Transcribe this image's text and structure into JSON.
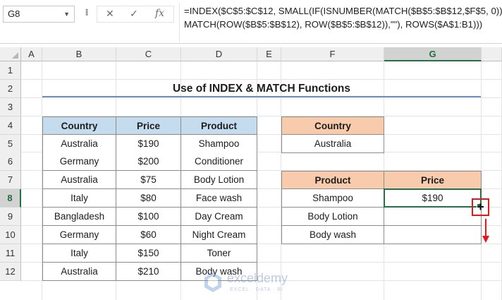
{
  "formula_bar": {
    "name_box": "G8",
    "cancel_symbol": "✕",
    "enter_symbol": "✓",
    "fx_symbol": "fx",
    "formula_line1": "=INDEX($C$5:$C$12, SMALL(IF(ISNUMBER(MATCH($B$5:$B$12,$F$5, 0)),",
    "formula_line2": "MATCH(ROW($B$5:$B$12), ROW($B$5:$B$12)),\"\"), ROWS($A$1:B1)))"
  },
  "columns": [
    "A",
    "B",
    "C",
    "D",
    "E",
    "F",
    "G"
  ],
  "rows": [
    "1",
    "2",
    "3",
    "4",
    "5",
    "6",
    "7",
    "8",
    "9",
    "10",
    "11",
    "12"
  ],
  "selected": {
    "column": "G",
    "row": "8"
  },
  "title": "Use of INDEX & MATCH Functions",
  "main_table": {
    "headers": [
      "Country",
      "Price",
      "Product"
    ],
    "rows": [
      [
        "Australia",
        "$190",
        "Shampoo"
      ],
      [
        "Germany",
        "$200",
        "Conditioner"
      ],
      [
        "Australia",
        "$75",
        "Body Lotion"
      ],
      [
        "Italy",
        "$80",
        "Face wash"
      ],
      [
        "Bangladesh",
        "$100",
        "Day Cream"
      ],
      [
        "Germany",
        "$60",
        "Night Cream"
      ],
      [
        "Italy",
        "$150",
        "Toner"
      ],
      [
        "Australia",
        "$210",
        "Body wash"
      ]
    ]
  },
  "criteria": {
    "header": "Country",
    "value": "Australia"
  },
  "result_table": {
    "headers": [
      "Product",
      "Price"
    ],
    "rows": [
      [
        "Shampoo",
        "$190"
      ],
      [
        "Body Lotion",
        ""
      ],
      [
        "Body wash",
        ""
      ]
    ]
  },
  "watermark": {
    "brand": "exceldemy",
    "tagline": "EXCEL · DATA · BI"
  },
  "colors": {
    "header_blue": "#c5dcef",
    "header_orange": "#f8cbad",
    "selection_green": "#217346",
    "highlight_red": "#e8161b"
  }
}
